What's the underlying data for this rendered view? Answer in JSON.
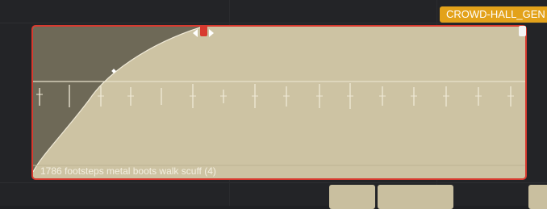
{
  "timeline": {
    "track_tag": "CROWD-HALL_GEN",
    "clip": {
      "name": "1786 footsteps metal boots walk scuff (4)",
      "selected": true
    },
    "handles": {
      "fade_handle": "fade-in-handle",
      "end_handle": "clip-end-handle"
    },
    "colors": {
      "clip_fill": "#cdc3a3",
      "clip_border_selected": "#d83a2f",
      "fade_shade": "#6e6957",
      "tag": "#e3a21a",
      "background": "#232427"
    }
  }
}
